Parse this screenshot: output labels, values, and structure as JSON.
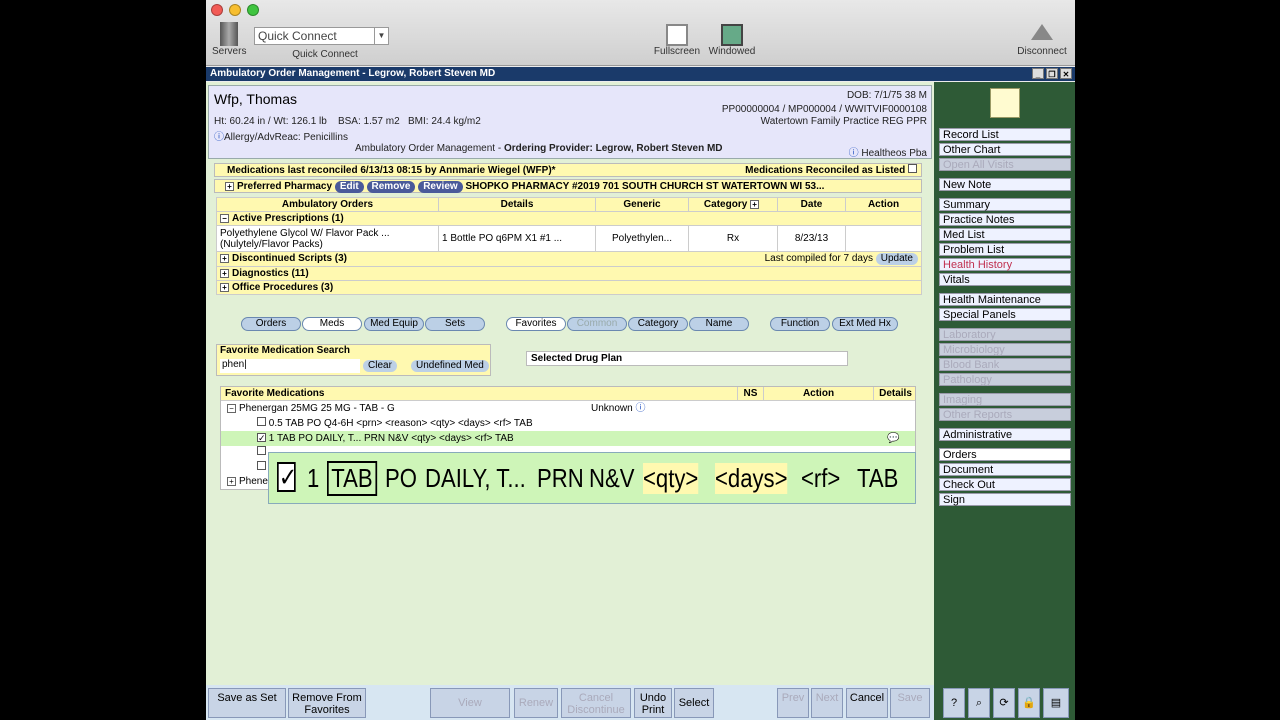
{
  "toolbar": {
    "servers": "Servers",
    "quick_connect_value": "Quick Connect",
    "quick_connect_label": "Quick Connect",
    "fullscreen": "Fullscreen",
    "windowed": "Windowed",
    "disconnect": "Disconnect"
  },
  "app_title": "Ambulatory Order Management - Legrow, Robert Steven MD",
  "patient": {
    "name": "Wfp, Thomas",
    "dob": "DOB: 7/1/75 38 M",
    "ids": "PP00000004 / MP000004 / WWITVIF0000108",
    "practice": "Watertown Family Practice  REG PPR",
    "vitals": "Ht: 60.24 in / Wt: 126.1 lb    BSA: 1.57 m2   BMI: 24.4 kg/m2",
    "allergy": "Allergy/AdvReac: Penicillins",
    "context": "Ambulatory Order Management - ",
    "provider": "Ordering Provider: Legrow, Robert Steven MD",
    "org": "Healtheos Pba"
  },
  "reconcile": {
    "text": "Medications last reconciled 6/13/13 08:15 by Annmarie Wiegel (WFP)*",
    "right": "Medications Reconciled as Listed"
  },
  "pharmacy": {
    "label": "Preferred Pharmacy",
    "edit": "Edit",
    "remove": "Remove",
    "review": "Review",
    "value": "SHOPKO PHARMACY #2019 701 SOUTH CHURCH ST WATERTOWN WI 53..."
  },
  "orders": {
    "headers": [
      "Ambulatory Orders",
      "Details",
      "Generic",
      "Category",
      "Date",
      "Action"
    ],
    "active": "Active Prescriptions (1)",
    "rx": {
      "name": "Polyethylene Glycol W/ Flavor Pack   ... (Nulytely/Flavor Packs)",
      "details": "1 Bottle PO q6PM X1 #1 ...",
      "generic": "Polyethylen...",
      "category": "Rx",
      "date": "8/23/13"
    },
    "discontinued": "Discontinued Scripts (3)",
    "compiled": "Last compiled for 7 days",
    "update": "Update",
    "diagnostics": "Diagnostics (11)",
    "office": "Office Procedures (3)"
  },
  "tabs": [
    "Orders",
    "Meds",
    "Med Equip",
    "Sets",
    "Favorites",
    "Common",
    "Category",
    "Name",
    "Function",
    "Ext Med Hx"
  ],
  "search": {
    "label": "Favorite Medication Search",
    "value": "phen|",
    "clear": "Clear",
    "undefined": "Undefined Med"
  },
  "drug_plan": "Selected Drug Plan",
  "favs": {
    "header": "Favorite Medications",
    "ns": "NS",
    "action": "Action",
    "details": "Details",
    "group": "Phenergan 25MG 25 MG - TAB - G",
    "unknown": "Unknown",
    "row1": "0.5  TAB  PO  Q4-6H  <prn>  <reason>  <qty>  <days>  <rf>  TAB",
    "row2": "1 TAB PO  DAILY, T...  PRN  N&V  <qty>  <days>  <rf>  TAB",
    "phene": "Phene"
  },
  "zoom": {
    "n": "1",
    "tab": "TAB",
    "po": "PO",
    "daily": "DAILY, T...",
    "prn": "PRN",
    "nv": "N&V",
    "qty": "<qty>",
    "days": "<days>",
    "rf": "<rf>",
    "tab2": "TAB"
  },
  "bottom": {
    "save_as_set": "Save as Set",
    "remove_fav": "Remove From Favorites",
    "view": "View",
    "renew": "Renew",
    "cancel_dc": "Cancel Discontinue",
    "undo_print": "Undo Print",
    "select": "Select",
    "prev": "Prev",
    "next": "Next",
    "cancel": "Cancel",
    "save": "Save"
  },
  "sidebar": [
    "Record List",
    "Other Chart",
    "Open All Visits",
    "New Note",
    "Summary",
    "Practice Notes",
    "Med List",
    "Problem List",
    "Health History",
    "Vitals",
    "Health Maintenance",
    "Special Panels",
    "Laboratory",
    "Microbiology",
    "Blood Bank",
    "Pathology",
    "Imaging",
    "Other Reports",
    "Administrative",
    "Orders",
    "Document",
    "Check Out",
    "Sign"
  ]
}
